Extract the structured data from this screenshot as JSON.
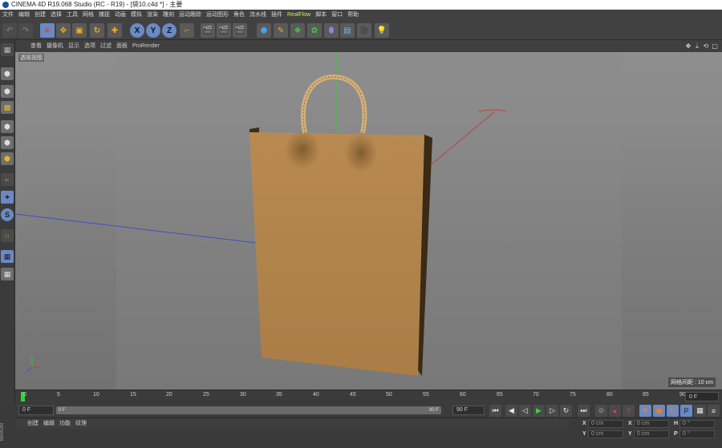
{
  "app": {
    "title": "CINEMA 4D R19.068 Studio (RC - R19) - [袋10.c4d *] - 主要"
  },
  "menu": [
    "文件",
    "编辑",
    "创建",
    "选择",
    "工具",
    "网格",
    "捕捉",
    "动画",
    "模拟",
    "渲染",
    "雕刻",
    "运动跟踪",
    "运动图形",
    "角色",
    "流水线",
    "插件",
    "RealFlow",
    "脚本",
    "窗口",
    "帮助"
  ],
  "viewport": {
    "menu": [
      "查看",
      "摄像机",
      "显示",
      "选项",
      "过滤",
      "面板",
      "ProRender"
    ],
    "nav_icons": "✥ ⇣ ⟲ ▢",
    "label": "透视视图",
    "grid_spacing": "网格间距 : 10 cm"
  },
  "timeline": {
    "ticks": [
      "0",
      "5",
      "10",
      "15",
      "20",
      "25",
      "30",
      "35",
      "40",
      "45",
      "50",
      "55",
      "60",
      "65",
      "70",
      "75",
      "80",
      "85",
      "90"
    ],
    "end_frame": "0 F"
  },
  "playback": {
    "current": "0 F",
    "range_start": "0 F",
    "range_end": "90 F",
    "max": "90 F"
  },
  "bottom": {
    "menu": [
      "创建",
      "编辑",
      "功能",
      "纹理"
    ],
    "coords": {
      "row1": [
        {
          "axis": "X",
          "value": "0 cm"
        },
        {
          "axis": "X",
          "value": "0 cm"
        },
        {
          "axis": "H",
          "value": "0 °"
        }
      ],
      "row2": [
        {
          "axis": "Y",
          "value": "0 cm"
        },
        {
          "axis": "Y",
          "value": "0 cm"
        },
        {
          "axis": "P",
          "value": "0 °"
        }
      ]
    },
    "side_text": "MAXON"
  },
  "colors": {
    "accent": "#d8e85a",
    "bag": "#b2864e",
    "axis_x": "#c04040",
    "axis_y": "#3ec23e",
    "axis_z": "#4050c0",
    "playhead": "#34d134"
  }
}
